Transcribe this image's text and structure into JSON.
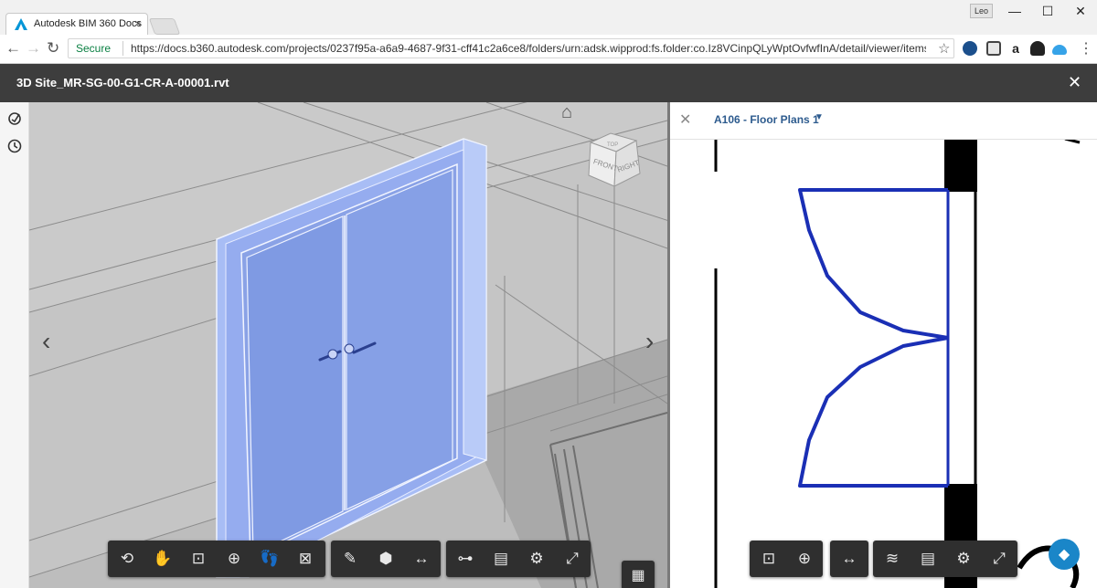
{
  "browser": {
    "tab_title": "Autodesk BIM 360 Docs",
    "tab_close": "×",
    "user_chip": "Leo",
    "window_controls": {
      "minimize": "—",
      "maximize": "☐",
      "close": "✕"
    },
    "secure_label": "Secure",
    "url": "https://docs.b360.autodesk.com/projects/0237f95a-a6a9-4687-9f31-cff41c2a6ce8/folders/urn:adsk.wipprod:fs.folder:co.Iz8VCinpQLyWptOvfwfInA/detail/viewer/items/urn:adsk.wippr",
    "nav": {
      "back": "←",
      "forward": "→",
      "reload": "↻",
      "star": "☆",
      "menu": "⋮"
    }
  },
  "app": {
    "file_title": "3D Site_MR-SG-00-G1-CR-A-00001.rvt",
    "close": "✕"
  },
  "viewer3d": {
    "home_icon": "⌂",
    "viewcube": {
      "front": "FRONT",
      "right": "RIGHT",
      "top": "TOP"
    },
    "prev": "‹",
    "next": "›",
    "tools_group1": [
      {
        "icon": "orbit-icon",
        "glyph": "⟲"
      },
      {
        "icon": "pan-hand-icon",
        "glyph": "✋"
      },
      {
        "icon": "fit-to-view-icon",
        "glyph": "⊡"
      },
      {
        "icon": "zoom-window-icon",
        "glyph": "⊕"
      },
      {
        "icon": "first-person-icon",
        "glyph": "👣"
      },
      {
        "icon": "section-box-icon",
        "glyph": "⊠"
      }
    ],
    "tools_group2": [
      {
        "icon": "markup-icon",
        "glyph": "✎"
      },
      {
        "icon": "explode-icon",
        "glyph": "⬢"
      },
      {
        "icon": "measure-icon",
        "glyph": "↔"
      }
    ],
    "tools_group3": [
      {
        "icon": "model-browser-icon",
        "glyph": "⊶"
      },
      {
        "icon": "properties-icon",
        "glyph": "▤"
      },
      {
        "icon": "settings-icon",
        "glyph": "⚙"
      },
      {
        "icon": "fullscreen-icon",
        "glyph": "⤢"
      }
    ],
    "grid_toggle": "▦"
  },
  "viewer2d": {
    "close": "✕",
    "sheet_name": "A106 - Floor Plans 1",
    "caret": "▼",
    "tools_group1": [
      {
        "icon": "fit-to-view-icon",
        "glyph": "⊡"
      },
      {
        "icon": "zoom-window-icon",
        "glyph": "⊕"
      }
    ],
    "tools_group2": [
      {
        "icon": "measure-icon",
        "glyph": "↔"
      }
    ],
    "tools_group3": [
      {
        "icon": "layers-icon",
        "glyph": "≋"
      },
      {
        "icon": "properties-icon",
        "glyph": "▤"
      },
      {
        "icon": "settings-icon",
        "glyph": "⚙"
      },
      {
        "icon": "fullscreen-icon",
        "glyph": "⤢"
      }
    ],
    "help_icon": "◆"
  }
}
